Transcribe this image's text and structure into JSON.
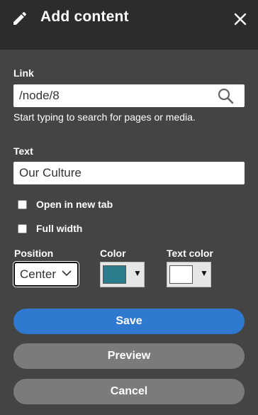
{
  "dialog": {
    "title": "Add content",
    "icons": {
      "title_icon": "pencil-icon",
      "close_icon": "close-icon",
      "search_icon": "search-icon"
    }
  },
  "link": {
    "label": "Link",
    "value": "/node/8",
    "help": "Start typing to search for pages or media."
  },
  "text": {
    "label": "Text",
    "value": "Our Culture"
  },
  "options": {
    "open_new_tab": {
      "label": "Open in new tab",
      "checked": false
    },
    "full_width": {
      "label": "Full width",
      "checked": false
    }
  },
  "position": {
    "label": "Position",
    "selected": "Center"
  },
  "color": {
    "label": "Color",
    "value": "#2a7d8c"
  },
  "text_color": {
    "label": "Text color",
    "value": "#ffffff"
  },
  "buttons": {
    "save": "Save",
    "preview": "Preview",
    "cancel": "Cancel"
  },
  "colors": {
    "background": "#444444",
    "header": "#2c2c2c",
    "primary": "#2f7ad0",
    "secondary": "#7b7b7b"
  }
}
